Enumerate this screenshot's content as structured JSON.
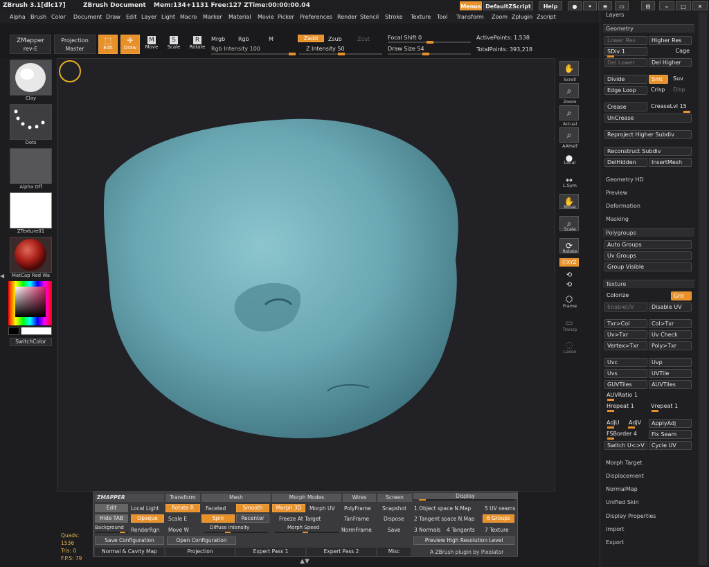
{
  "titlebar": {
    "app": "ZBrush  3.1[dlc17]",
    "doc": "ZBrush Document",
    "mem": "Mem:134+1131  Free:127  ZTime:00:00:00.04",
    "menus": "Menus",
    "script": "DefaultZScript",
    "help": "Help"
  },
  "menubar": [
    "Alpha",
    "Brush",
    "Color",
    "Document",
    "Draw",
    "Edit",
    "Layer",
    "Light",
    "Macro",
    "Marker",
    "Material",
    "Movie",
    "Picker",
    "Preferences",
    "Render",
    "Stencil",
    "Stroke",
    "Texture",
    "Tool",
    "Transform",
    "Zoom",
    "Zplugin",
    "Zscript"
  ],
  "toolbar": {
    "zmapper": "ZMapper",
    "zmapper_rev": "rev-E",
    "proj": "Projection",
    "proj2": "Master",
    "edit": "Edit",
    "draw": "Draw",
    "move": "Move",
    "scale": "Scale",
    "rotate": "Rotate",
    "mrgb": "Mrgb",
    "rgb": "Rgb",
    "m": "M",
    "rgb_intensity": "Rgb Intensity 100",
    "zadd": "Zadd",
    "zsub": "Zsub",
    "zcut": "Zcut",
    "z_intensity": "Z Intensity 50",
    "focal": "Focal Shift 0",
    "drawsize": "Draw Size 54",
    "active": "ActivePoints: 1,538",
    "total": "TotalPoints: 393,218"
  },
  "leftshelf": {
    "brush": "Clay",
    "stroke": "Dots",
    "alpha": "Alpha  Off",
    "texture": "ZTexture01",
    "material": "MatCap Red Wa",
    "switch": "SwitchColor"
  },
  "rightshelf": [
    "Scroll",
    "Zoom",
    "Actual",
    "AAHalf",
    "Local",
    "L.Sym",
    "Move",
    "Scale",
    "Rotate",
    "",
    "",
    "Frame",
    "Transp",
    "Lasso"
  ],
  "rightshelf_xyz": "ⒸXYZ",
  "tray": {
    "layers": "Layers",
    "geometry": "Geometry",
    "lower": "Lower Res",
    "higher": "Higher Res",
    "sdiv": "SDiv 1",
    "cage": "Cage",
    "dellower": "Del Lower",
    "delhigher": "Del Higher",
    "divide": "Divide",
    "smt": "Smt",
    "suv": "Suv",
    "edgeloop": "Edge Loop",
    "crisp": "Crisp",
    "disp": "Disp",
    "crease": "Crease",
    "creaselvl": "CreaseLvl 15",
    "uncrease": "UnCrease",
    "reproject": "Reproject Higher Subdiv",
    "reconstruct": "Reconstruct Subdiv",
    "delhidden": "DelHidden",
    "insertmesh": "InsertMesh",
    "geohd": "Geometry HD",
    "preview": "Preview",
    "deformation": "Deformation",
    "masking": "Masking",
    "polygroups": "Polygroups",
    "autogroups": "Auto Groups",
    "uvgroups": "Uv Groups",
    "groupvisible": "Group Visible",
    "texture": "Texture",
    "colorize": "Colorize",
    "grd": "Grd",
    "enableuv": "EnableUV",
    "disableuv": "Disable UV",
    "txrcol": "Txr>Col",
    "coltxr": "Col>Txr",
    "uvtxr": "Uv>Txr",
    "uvcheck": "Uv Check",
    "vertextxr": "Vertex>Txr",
    "polytxr": "Poly>Txr",
    "uvc": "Uvc",
    "uvp": "Uvp",
    "uvs": "Uvs",
    "uvtile": "UVTile",
    "guvtiles": "GUVTiles",
    "auvtiles": "AUVTiles",
    "auvratio": "AUVRatio 1",
    "hrepeat": "Hrepeat 1",
    "vrepeat": "Vrepeat 1",
    "adju": "AdjU",
    "adjv": "AdjV",
    "applyadj": "ApplyAdj",
    "fsborder": "FSBorder 4",
    "fixseam": "Fix Seam",
    "switchuv": "Switch U<>V",
    "cycleuv": "Cycle UV",
    "morph": "Morph Target",
    "displacement": "Displacement",
    "normalmap": "NormalMap",
    "unified": "Unified Skin",
    "display": "Display Properties",
    "import": "Import",
    "export": "Export"
  },
  "zm": {
    "title": "ZMAPPER",
    "transform": "Transform",
    "mesh": "Mesh",
    "morphmodes": "Morph Modes",
    "wires": "Wires",
    "screen": "Screen",
    "display": "Display",
    "edit": "Edit",
    "locallight": "Local Light",
    "rotate": "Rotate  R",
    "faceted": "Faceted",
    "smooth": "Smooth",
    "morph3d": "Morph 3D",
    "morphuv": "Morph UV",
    "polyframe": "PolyFrame",
    "snapshot": "Snapshot",
    "objspace": "1 Object space N.Map",
    "uvseams": "5 UV seams",
    "hidetab": "Hide TAB",
    "opaque": "Opaque",
    "scale": "Scale   E",
    "spin": "Spin",
    "recenter": "Recenter",
    "freeze": "Freeze At Target",
    "tanframe": "TanFrame",
    "dispose": "Dispose",
    "tanspace": "2 Tangent space N.Map",
    "groups": "6 Groups",
    "background": "Background",
    "renderrgn": "RenderRgn",
    "move": "Move    W",
    "diffuse": "Diffuse Intensity",
    "morphspeed": "Morph Speed",
    "normframe": "NormFrame",
    "save": "Save",
    "normals": "3 Normals",
    "tangents": "4 Tangents",
    "texture": "7 Texture",
    "saveconf": "Save Configuration",
    "openconf": "Open Configuration",
    "previewhi": "Preview High Resolution Level",
    "tab1": "Normal & Cavity Map",
    "tab2": "Projection",
    "tab3": "Expert Pass 1",
    "tab4": "Expert Pass 2",
    "tab5": "Misc",
    "credit": "A ZBrush plugin by Pixolator"
  },
  "stats": {
    "quads": "Quads: 1536",
    "tris": "Tris: 0",
    "fps": "F.P.S: 79"
  },
  "colors": {
    "accent": "#e8912b",
    "mesh": "#6aa7b2"
  }
}
